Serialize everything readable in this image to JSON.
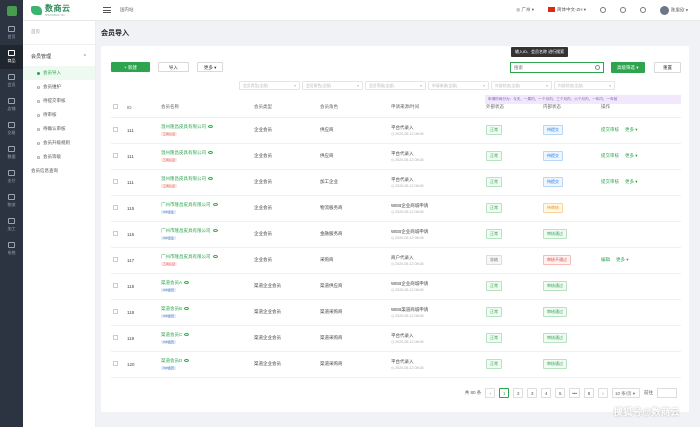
{
  "app": {
    "brand": "数商云",
    "brand_sub": "SHUSHANGYUN",
    "top_crumb": "国内站",
    "location": "广州",
    "language": "简体中文-ZH",
    "user": "陈果欣"
  },
  "rail": [
    "首页",
    "商品",
    "会员",
    "店铺",
    "交易",
    "数据",
    "支付",
    "物流",
    "加工",
    "系统"
  ],
  "sidebar": {
    "top": "首页",
    "group": "会员管理",
    "items": [
      "会员导入",
      "会员维护",
      "待提交审核",
      "待审核",
      "待确认审核",
      "会员升级规则",
      "会员等级"
    ],
    "plain": "会员信息查询"
  },
  "page": {
    "title": "会员导入"
  },
  "toolbar": {
    "new_label": "+ 新建",
    "import_label": "导入",
    "more_label": "更多",
    "search_placeholder": "搜索",
    "tooltip": "输入ID、会员名称 进行搜索",
    "advanced_label": "高级筛选",
    "reset_label": "重置"
  },
  "filters": [
    "会员类型(全部)",
    "会员角色(全部)",
    "会员等级(全部)",
    "申请来源(全部)",
    "外部状态(全部)",
    "内部状态(全部)"
  ],
  "hint": "申请时间分为：今天、一周内、一个月内、三个月内、六个月内、一年内、一年前",
  "table": {
    "headers": [
      "",
      "ID",
      "会员名称",
      "会员类型",
      "会员角色",
      "申请来源/时间",
      "外部状态",
      "内部状态",
      "操作"
    ],
    "rows": [
      {
        "id": "111",
        "name": "温州隆昌皮具有限公司",
        "cert": "工商认证",
        "certType": "red",
        "type": "企业会员",
        "role": "供应商",
        "source": "平台代录入",
        "time": "2020-05-12 08:08",
        "ext": "正常",
        "extCls": "ok",
        "inner": "待提交",
        "innerCls": "pend",
        "act": "提交审核",
        "more": "更多"
      },
      {
        "id": "111",
        "name": "温州隆昌皮具有限公司",
        "cert": "工商认证",
        "certType": "red",
        "type": "企业会员",
        "role": "供应商",
        "source": "平台代录入",
        "time": "2020-05-12 08:08",
        "ext": "正常",
        "extCls": "ok",
        "inner": "待提交",
        "innerCls": "pend",
        "act": "提交审核",
        "more": "更多"
      },
      {
        "id": "111",
        "name": "温州隆昌皮具有限公司",
        "cert": "工商认证",
        "certType": "red",
        "type": "企业会员",
        "role": "加工企业",
        "source": "平台代录入",
        "time": "2020-05-12 08:08",
        "ext": "正常",
        "extCls": "ok",
        "inner": "待提交",
        "innerCls": "pend",
        "act": "提交审核",
        "more": "更多"
      },
      {
        "id": "115",
        "name": "广州市隆昌皮具有限公司",
        "cert": "VIP企业",
        "certType": "blue",
        "type": "企业会员",
        "role": "物流服务商",
        "source": "WEB企业商城申请",
        "time": "2020-05-12 08:08",
        "ext": "正常",
        "extCls": "ok",
        "inner": "待审核",
        "innerCls": "wait",
        "act": "",
        "more": ""
      },
      {
        "id": "116",
        "name": "广州市隆昌皮具有限公司",
        "cert": "VIP企业",
        "certType": "blue",
        "type": "企业会员",
        "role": "金融服务商",
        "source": "WEB企业商城申请",
        "time": "2020-05-12 08:08",
        "ext": "正常",
        "extCls": "ok",
        "inner": "审核通过",
        "innerCls": "pass",
        "act": "",
        "more": ""
      },
      {
        "id": "117",
        "name": "广州市隆昌皮具有限公司",
        "cert": "工商认证",
        "certType": "red",
        "type": "企业会员",
        "role": "采购商",
        "source": "商户代录入",
        "time": "2020-05-12 08:08",
        "ext": "冻结",
        "extCls": "off",
        "inner": "审核不通过",
        "innerCls": "rej",
        "act": "编辑",
        "more": "更多"
      },
      {
        "id": "118",
        "name": "渠道会员A",
        "cert": "VIP会员",
        "certType": "blue",
        "type": "渠道企业会员",
        "role": "渠道供应商",
        "source": "WEB企业商城申请",
        "time": "2020-05-12 08:08",
        "ext": "正常",
        "extCls": "ok",
        "inner": "审核通过",
        "innerCls": "pass",
        "act": "",
        "more": ""
      },
      {
        "id": "118",
        "name": "渠道会员B",
        "cert": "VIP会员",
        "certType": "blue",
        "type": "渠道企业会员",
        "role": "渠道采购商",
        "source": "WEB渠道商城申请",
        "time": "2020-05-12 08:08",
        "ext": "正常",
        "extCls": "ok",
        "inner": "审核通过",
        "innerCls": "pass",
        "act": "",
        "more": ""
      },
      {
        "id": "119",
        "name": "渠道会员C",
        "cert": "VIP会员",
        "certType": "blue",
        "type": "渠道企业会员",
        "role": "渠道采购商",
        "source": "平台代录入",
        "time": "2020-05-12 08:08",
        "ext": "正常",
        "extCls": "ok",
        "inner": "审核通过",
        "innerCls": "pass",
        "act": "",
        "more": ""
      },
      {
        "id": "120",
        "name": "渠道会员D",
        "cert": "VIP会员",
        "certType": "blue",
        "type": "渠道企业会员",
        "role": "渠道采购商",
        "source": "平台代录入",
        "time": "2020-05-12 08:08",
        "ext": "正常",
        "extCls": "ok",
        "inner": "审核通过",
        "innerCls": "pass",
        "act": "",
        "more": ""
      }
    ]
  },
  "pager": {
    "total": "共 80 条",
    "pages": [
      "1",
      "2",
      "3",
      "4",
      "5",
      "•••",
      "8"
    ],
    "size": "10 条/页",
    "jump": "前往"
  },
  "watermark": "搜狐号@数商云",
  "colors": {
    "primary": "#2ea44f",
    "rail": "#2b3440"
  }
}
